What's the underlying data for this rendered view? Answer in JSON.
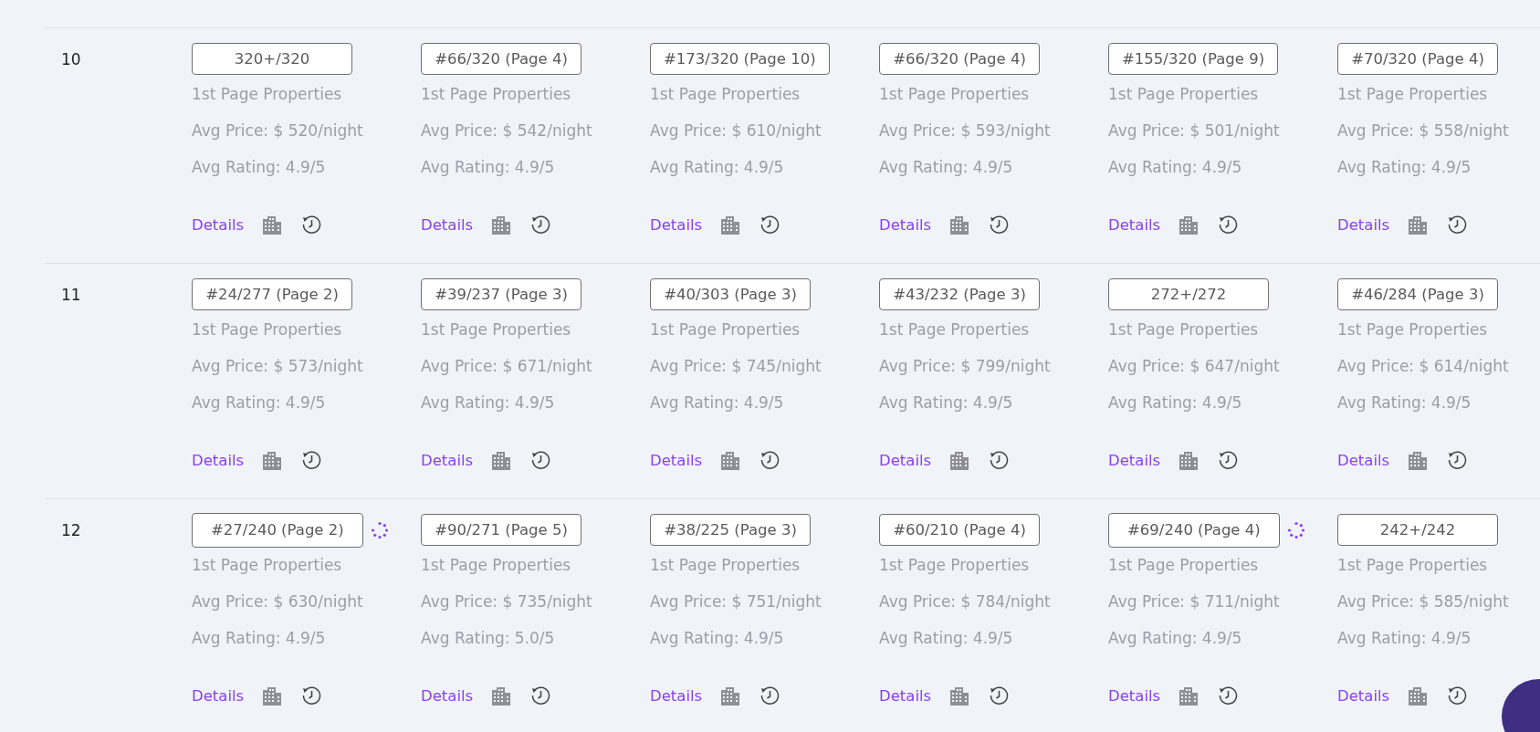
{
  "rows": [
    {
      "number": "10",
      "cells": [
        {
          "rank": "320+/320",
          "loading": false,
          "label": "1st Page Properties",
          "price": "Avg Price: $ 520/night",
          "rating": "Avg Rating: 4.9/5",
          "details": "Details"
        },
        {
          "rank": "#66/320 (Page 4)",
          "loading": false,
          "label": "1st Page Properties",
          "price": "Avg Price: $ 542/night",
          "rating": "Avg Rating: 4.9/5",
          "details": "Details"
        },
        {
          "rank": "#173/320 (Page 10)",
          "loading": false,
          "label": "1st Page Properties",
          "price": "Avg Price: $ 610/night",
          "rating": "Avg Rating: 4.9/5",
          "details": "Details"
        },
        {
          "rank": "#66/320 (Page 4)",
          "loading": false,
          "label": "1st Page Properties",
          "price": "Avg Price: $ 593/night",
          "rating": "Avg Rating: 4.9/5",
          "details": "Details"
        },
        {
          "rank": "#155/320 (Page 9)",
          "loading": false,
          "label": "1st Page Properties",
          "price": "Avg Price: $ 501/night",
          "rating": "Avg Rating: 4.9/5",
          "details": "Details"
        },
        {
          "rank": "#70/320 (Page 4)",
          "loading": false,
          "label": "1st Page Properties",
          "price": "Avg Price: $ 558/night",
          "rating": "Avg Rating: 4.9/5",
          "details": "Details"
        }
      ]
    },
    {
      "number": "11",
      "cells": [
        {
          "rank": "#24/277 (Page 2)",
          "loading": false,
          "label": "1st Page Properties",
          "price": "Avg Price: $ 573/night",
          "rating": "Avg Rating: 4.9/5",
          "details": "Details"
        },
        {
          "rank": "#39/237 (Page 3)",
          "loading": false,
          "label": "1st Page Properties",
          "price": "Avg Price: $ 671/night",
          "rating": "Avg Rating: 4.9/5",
          "details": "Details"
        },
        {
          "rank": "#40/303 (Page 3)",
          "loading": false,
          "label": "1st Page Properties",
          "price": "Avg Price: $ 745/night",
          "rating": "Avg Rating: 4.9/5",
          "details": "Details"
        },
        {
          "rank": "#43/232 (Page 3)",
          "loading": false,
          "label": "1st Page Properties",
          "price": "Avg Price: $ 799/night",
          "rating": "Avg Rating: 4.9/5",
          "details": "Details"
        },
        {
          "rank": "272+/272",
          "loading": false,
          "label": "1st Page Properties",
          "price": "Avg Price: $ 647/night",
          "rating": "Avg Rating: 4.9/5",
          "details": "Details"
        },
        {
          "rank": "#46/284 (Page 3)",
          "loading": false,
          "label": "1st Page Properties",
          "price": "Avg Price: $ 614/night",
          "rating": "Avg Rating: 4.9/5",
          "details": "Details"
        }
      ]
    },
    {
      "number": "12",
      "cells": [
        {
          "rank": "#27/240 (Page 2)",
          "loading": true,
          "label": "1st Page Properties",
          "price": "Avg Price: $ 630/night",
          "rating": "Avg Rating: 4.9/5",
          "details": "Details"
        },
        {
          "rank": "#90/271 (Page 5)",
          "loading": false,
          "label": "1st Page Properties",
          "price": "Avg Price: $ 735/night",
          "rating": "Avg Rating: 5.0/5",
          "details": "Details"
        },
        {
          "rank": "#38/225 (Page 3)",
          "loading": false,
          "label": "1st Page Properties",
          "price": "Avg Price: $ 751/night",
          "rating": "Avg Rating: 4.9/5",
          "details": "Details"
        },
        {
          "rank": "#60/210 (Page 4)",
          "loading": false,
          "label": "1st Page Properties",
          "price": "Avg Price: $ 784/night",
          "rating": "Avg Rating: 4.9/5",
          "details": "Details"
        },
        {
          "rank": "#69/240 (Page 4)",
          "loading": true,
          "label": "1st Page Properties",
          "price": "Avg Price: $ 711/night",
          "rating": "Avg Rating: 4.9/5",
          "details": "Details"
        },
        {
          "rank": "242+/242",
          "loading": false,
          "label": "1st Page Properties",
          "price": "Avg Price: $ 585/night",
          "rating": "Avg Rating: 4.9/5",
          "details": "Details"
        }
      ]
    }
  ]
}
